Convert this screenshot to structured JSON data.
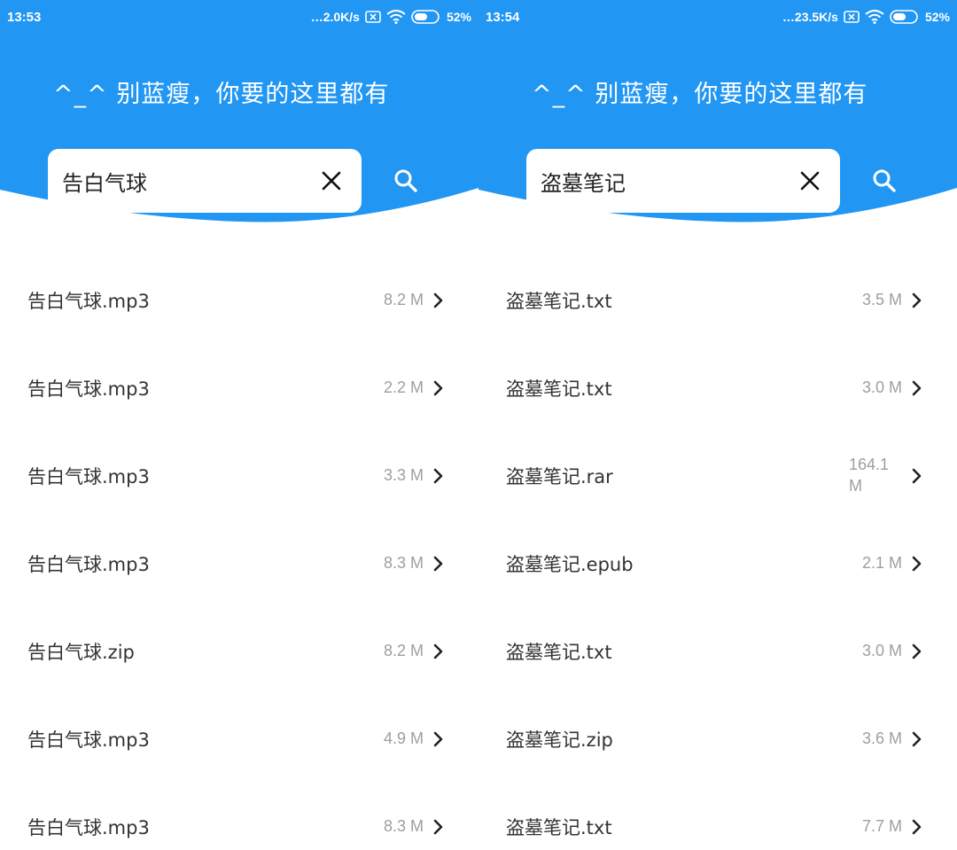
{
  "colors": {
    "header": "#2196F3",
    "text": "#333333",
    "size": "#9e9e9e"
  },
  "screens": [
    {
      "status": {
        "time": "13:53",
        "speed": "…2.0K/s",
        "battery": "52%"
      },
      "title": "^_^ 别蓝瘦，你要的这里都有",
      "search_value": "告白气球",
      "items": [
        {
          "name": "告白气球.mp3",
          "size": "8.2 M"
        },
        {
          "name": "告白气球.mp3",
          "size": "2.2 M"
        },
        {
          "name": "告白气球.mp3",
          "size": "3.3 M"
        },
        {
          "name": "告白气球.mp3",
          "size": "8.3 M"
        },
        {
          "name": "告白气球.zip",
          "size": "8.2 M"
        },
        {
          "name": "告白气球.mp3",
          "size": "4.9 M"
        },
        {
          "name": "告白气球.mp3",
          "size": "8.3 M"
        }
      ]
    },
    {
      "status": {
        "time": "13:54",
        "speed": "…23.5K/s",
        "battery": "52%"
      },
      "title": "^_^ 别蓝瘦，你要的这里都有",
      "search_value": "盗墓笔记",
      "items": [
        {
          "name": "盗墓笔记.txt",
          "size": "3.5 M"
        },
        {
          "name": "盗墓笔记.txt",
          "size": "3.0 M"
        },
        {
          "name": "盗墓笔记.rar",
          "size": "164.1 M"
        },
        {
          "name": "盗墓笔记.epub",
          "size": "2.1 M"
        },
        {
          "name": "盗墓笔记.txt",
          "size": "3.0 M"
        },
        {
          "name": "盗墓笔记.zip",
          "size": "3.6 M"
        },
        {
          "name": "盗墓笔记.txt",
          "size": "7.7 M"
        }
      ]
    }
  ]
}
